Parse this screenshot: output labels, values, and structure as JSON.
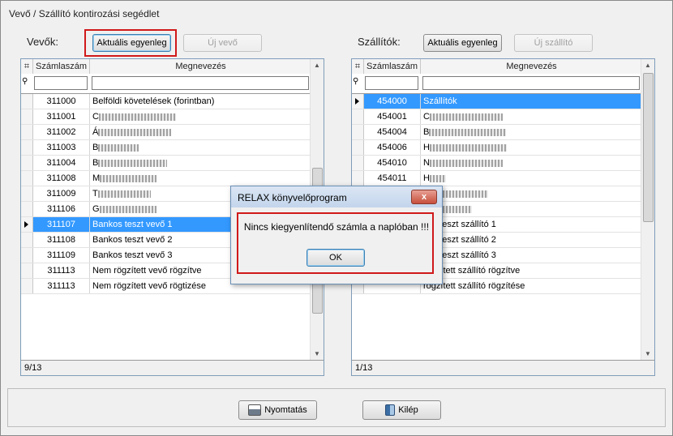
{
  "window": {
    "title": "Vevő / Szállító kontirozási segédlet"
  },
  "customers": {
    "label": "Vevők:",
    "balance_button": "Aktuális egyenleg",
    "new_button": "Új vevő",
    "col_account": "Számlaszám",
    "col_name": "Megnevezés",
    "status": "9/13",
    "rows": [
      {
        "acct": "311000",
        "name": "Belföldi követelések (forintban)"
      },
      {
        "acct": "311001",
        "name": "C"
      },
      {
        "acct": "311002",
        "name": "Á"
      },
      {
        "acct": "311003",
        "name": "B"
      },
      {
        "acct": "311004",
        "name": "B"
      },
      {
        "acct": "311008",
        "name": "M"
      },
      {
        "acct": "311009",
        "name": "T"
      },
      {
        "acct": "311106",
        "name": "G"
      },
      {
        "acct": "311107",
        "name": "Bankos teszt vevő 1"
      },
      {
        "acct": "311108",
        "name": "Bankos teszt vevő 2"
      },
      {
        "acct": "311109",
        "name": "Bankos teszt vevő 3"
      },
      {
        "acct": "311113",
        "name": "Nem rögzített vevő rögzítve"
      },
      {
        "acct": "311113",
        "name": "Nem rögzített vevő rögtizése"
      }
    ]
  },
  "suppliers": {
    "label": "Szállítók:",
    "balance_button": "Aktuális egyenleg",
    "new_button": "Új szállító",
    "col_account": "Számlaszám",
    "col_name": "Megnevezés",
    "status": "1/13",
    "rows": [
      {
        "acct": "454000",
        "name": "Szállítók"
      },
      {
        "acct": "454001",
        "name": "C"
      },
      {
        "acct": "454004",
        "name": "B"
      },
      {
        "acct": "454006",
        "name": "H"
      },
      {
        "acct": "454010",
        "name": "N"
      },
      {
        "acct": "454011",
        "name": "H"
      },
      {
        "acct": "",
        "name": ""
      },
      {
        "acct": "",
        "name": ""
      },
      {
        "acct": "",
        "name": "kos teszt szállító 1"
      },
      {
        "acct": "",
        "name": "kos teszt szállító 2"
      },
      {
        "acct": "",
        "name": "kos teszt szállító 3"
      },
      {
        "acct": "",
        "name": "rögzített szállító rögzítve"
      },
      {
        "acct": "",
        "name": "rögzített szállító rögzítése"
      }
    ]
  },
  "dialog": {
    "title": "RELAX könyvelőprogram",
    "close": "x",
    "message": "Nincs kiegyenlítendő számla a naplóban !!!",
    "ok": "OK"
  },
  "footer": {
    "print": "Nyomtatás",
    "exit": "Kilép"
  },
  "colors": {
    "selection": "#3399ff",
    "highlight": "#d0191a"
  }
}
